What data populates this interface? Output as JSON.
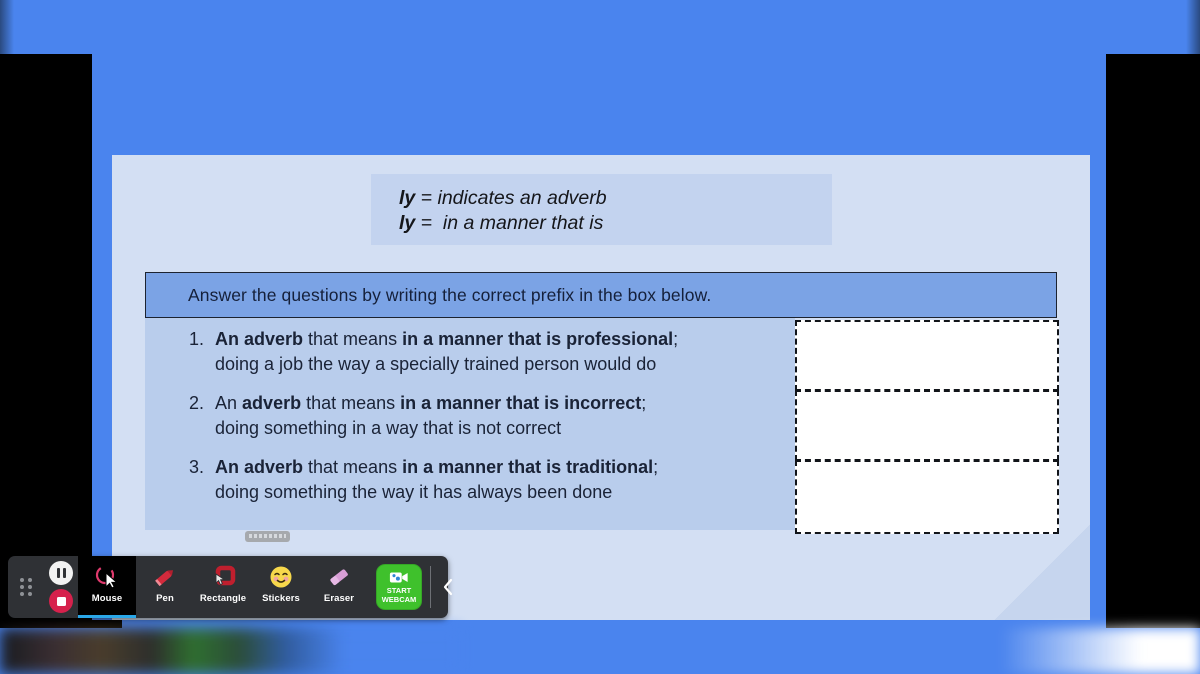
{
  "slide": {
    "definition_box": {
      "line1_prefix": "ly",
      "line1_text": " = indicates an adverb",
      "line2_prefix": "ly",
      "line2_text": " =  in a manner that is"
    },
    "instruction": "Answer the questions by writing the correct prefix in the box below.",
    "questions": [
      {
        "number": "1.",
        "bold1": "An adverb",
        "mid": " that means ",
        "bold2": "in a manner that is professional",
        "tail": ";",
        "line2": "doing a job the way a specially trained person would do"
      },
      {
        "number": "2.",
        "bold1": "An",
        "bold1_is_bold": false,
        "mid": " that means ",
        "bold2": "in a manner that is incorrect",
        "tail": ";",
        "line2": "doing something in a way that is not correct",
        "inline_bold": "adverb"
      },
      {
        "number": "3.",
        "bold1": "An adverb",
        "mid": " that means  ",
        "bold2": "in a manner that is traditional",
        "tail": ";",
        "line2": "doing something the way it has always been done"
      }
    ],
    "answer_boxes": [
      "",
      "",
      ""
    ]
  },
  "toolbar": {
    "recording": {
      "pause_label": "Pause recording",
      "stop_label": "Stop recording"
    },
    "tools": [
      {
        "label": "Mouse",
        "icon": "mouse-cursor-icon",
        "active": true
      },
      {
        "label": "Pen",
        "icon": "pen-icon",
        "active": false
      },
      {
        "label": "Rectangle",
        "icon": "rectangle-icon",
        "active": false
      },
      {
        "label": "Stickers",
        "icon": "smiley-sticker-icon",
        "active": false
      },
      {
        "label": "Eraser",
        "icon": "eraser-icon",
        "active": false
      }
    ],
    "webcam": {
      "line1": "START",
      "line2": "WEBCAM",
      "color": "#3fc12c"
    },
    "collapse_label": "‹"
  },
  "colors": {
    "backdrop_blue": "#4a84ee",
    "slide_bg": "#d3dff3",
    "definition_bg": "#c3d3ef",
    "question_header_bg": "#7ba3e5",
    "question_body_bg": "#b9cdec",
    "toolbar_bg": "#2f3135",
    "accent_active": "#2aa7e8",
    "record_red": "#d6214c"
  }
}
